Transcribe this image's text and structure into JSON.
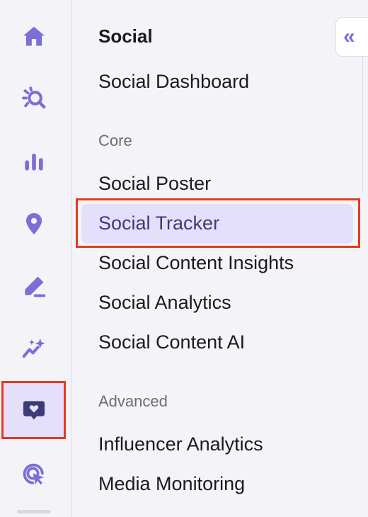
{
  "colors": {
    "accent": "#7b6fd6",
    "highlight_bg": "#e4e0fc",
    "annotation": "#e8391e"
  },
  "rail": {
    "items": [
      {
        "icon": "home-icon"
      },
      {
        "icon": "search-gear-icon"
      },
      {
        "icon": "bar-chart-icon"
      },
      {
        "icon": "location-pin-icon"
      },
      {
        "icon": "edit-pencil-icon"
      },
      {
        "icon": "sparkle-trend-icon"
      },
      {
        "icon": "heart-chat-icon",
        "active": true
      },
      {
        "icon": "cursor-click-icon"
      }
    ]
  },
  "panel": {
    "title": "Social",
    "dashboard": "Social Dashboard",
    "sections": [
      {
        "label": "Core",
        "items": [
          "Social Poster",
          "Social Tracker",
          "Social Content Insights",
          "Social Analytics",
          "Social Content AI"
        ]
      },
      {
        "label": "Advanced",
        "items": [
          "Influencer Analytics",
          "Media Monitoring"
        ]
      }
    ],
    "selected_item": "Social Tracker"
  },
  "collapse_button": {
    "icon": "double-chevron-left-icon",
    "glyph": "«"
  }
}
